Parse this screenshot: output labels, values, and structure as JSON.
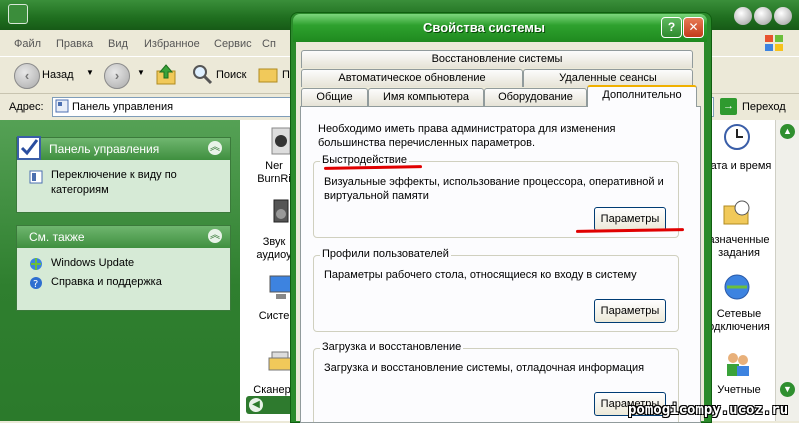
{
  "explorer": {
    "menu": [
      "Файл",
      "Правка",
      "Вид",
      "Избранное",
      "Сервис",
      "Сп"
    ],
    "toolbar": {
      "back": "Назад",
      "search": "Поиск",
      "folders_partial": "П"
    },
    "address": {
      "label": "Адрес:",
      "value": "Панель управления",
      "go": "Переход"
    },
    "panels": {
      "control_panel": {
        "title": "Панель управления",
        "link": "Переключение к виду по категориям"
      },
      "see_also": {
        "title": "См. также",
        "links": [
          "Windows Update",
          "Справка и поддержка"
        ]
      }
    },
    "left_items": [
      {
        "label": "Ner\nBurnRi",
        "icon": "nero-icon"
      },
      {
        "label": "Звук\nаудиоу",
        "icon": "speaker-icon"
      },
      {
        "label": "Систе",
        "icon": "computer-icon"
      },
      {
        "label": "Сканер",
        "icon": "scanner-icon"
      }
    ],
    "right_items": [
      {
        "label": "ата и время",
        "icon": "clock-icon"
      },
      {
        "label": "азначенные\nзадания",
        "icon": "scheduled-tasks-icon"
      },
      {
        "label": "Сетевые\nодключения",
        "icon": "network-icon"
      },
      {
        "label": "Учетные",
        "icon": "users-icon"
      }
    ]
  },
  "dialog": {
    "title": "Свойства системы",
    "help_button": "?",
    "close_button": "✕",
    "tabs_row1": [
      "Восстановление системы"
    ],
    "tabs_row2": [
      "Автоматическое обновление",
      "Удаленные сеансы"
    ],
    "tabs_row3": [
      "Общие",
      "Имя компьютера",
      "Оборудование",
      "Дополнительно"
    ],
    "active_tab": "Дополнительно",
    "intro": "Необходимо иметь права администратора для изменения большинства перечисленных параметров.",
    "groups": [
      {
        "title": "Быстродействие",
        "text": "Визуальные эффекты, использование процессора, оперативной и виртуальной памяти",
        "button": "Параметры"
      },
      {
        "title": "Профили пользователей",
        "text": "Параметры рабочего стола, относящиеся ко входу в систему",
        "button": "Параметры"
      },
      {
        "title": "Загрузка и восстановление",
        "text": "Загрузка и восстановление системы, отладочная информация",
        "button": "Параметры"
      }
    ]
  },
  "watermark": "pomogicompy.ucoz.ru",
  "colors": {
    "theme_green": "#2b8a2b",
    "annotation_red": "#e00000"
  }
}
